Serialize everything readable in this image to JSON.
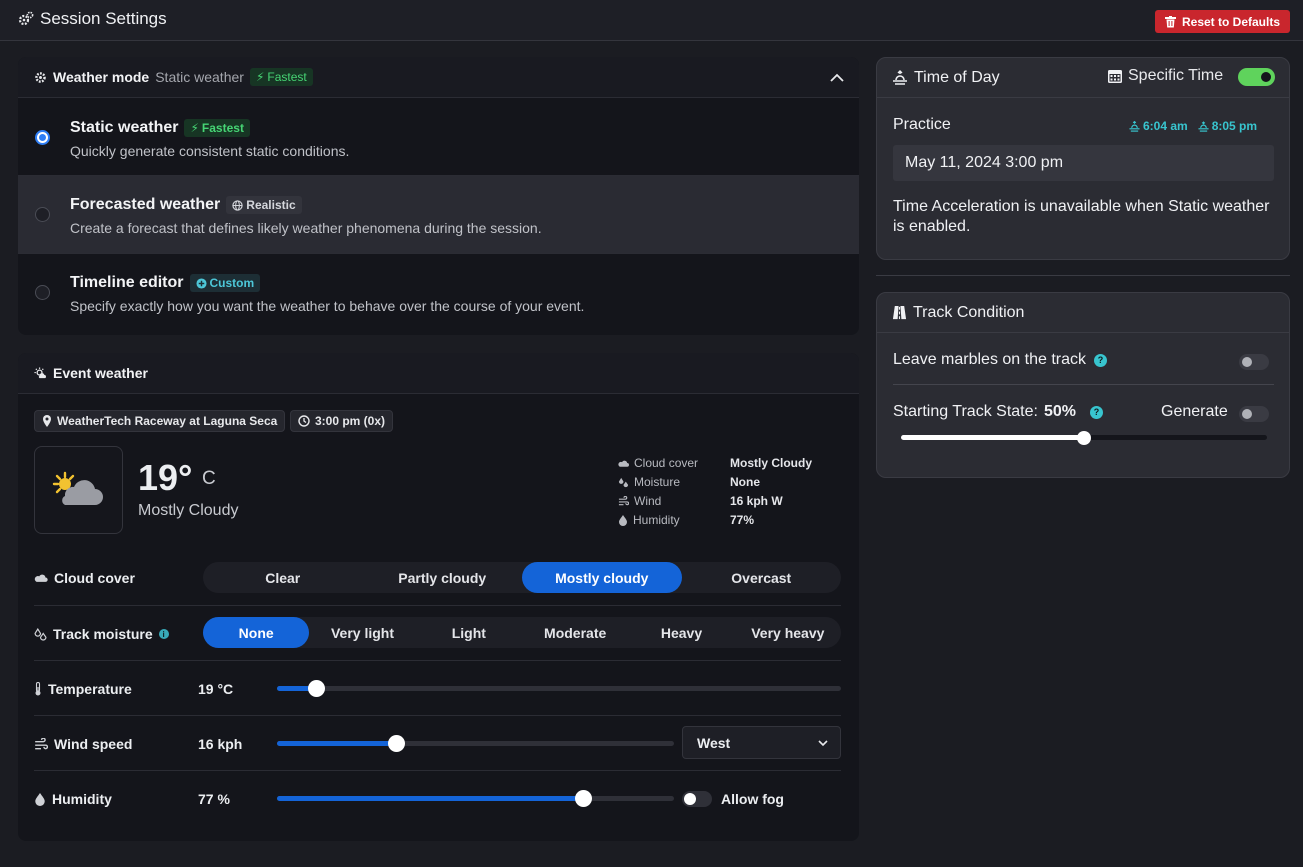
{
  "header": {
    "title": "Session Settings",
    "reset_label": "Reset to Defaults"
  },
  "weather_mode": {
    "label": "Weather mode",
    "current": "Static weather",
    "current_badge": "Fastest",
    "options": [
      {
        "title": "Static weather",
        "badge": "Fastest",
        "desc": "Quickly generate consistent static conditions.",
        "selected": true
      },
      {
        "title": "Forecasted weather",
        "badge": "Realistic",
        "desc": "Create a forecast that defines likely weather phenomena during the session.",
        "selected": false
      },
      {
        "title": "Timeline editor",
        "badge": "Custom",
        "desc": "Specify exactly how you want the weather to behave over the course of your event.",
        "selected": false
      }
    ]
  },
  "event_weather": {
    "title": "Event weather",
    "track": "WeatherTech Raceway at Laguna Seca",
    "time": "3:00 pm (0x)",
    "temp": "19°",
    "unit": "C",
    "condition": "Mostly Cloudy",
    "stats": [
      {
        "label": "Cloud cover",
        "value": "Mostly Cloudy"
      },
      {
        "label": "Moisture",
        "value": "None"
      },
      {
        "label": "Wind",
        "value": "16 kph W"
      },
      {
        "label": "Humidity",
        "value": "77%"
      }
    ],
    "cloud_cover": {
      "label": "Cloud cover",
      "options": [
        "Clear",
        "Partly cloudy",
        "Mostly cloudy",
        "Overcast"
      ],
      "selected": "Mostly cloudy"
    },
    "track_moisture": {
      "label": "Track moisture",
      "options": [
        "None",
        "Very light",
        "Light",
        "Moderate",
        "Heavy",
        "Very heavy"
      ],
      "selected": "None"
    },
    "temperature": {
      "label": "Temperature",
      "value": "19 °C",
      "level": 0.07
    },
    "wind_speed": {
      "label": "Wind speed",
      "value": "16 kph",
      "level": 0.3,
      "direction": "West"
    },
    "humidity": {
      "label": "Humidity",
      "value": "77 %",
      "level": 0.77,
      "fog_label": "Allow fog"
    }
  },
  "time_of_day": {
    "title": "Time of Day",
    "toggle_label": "Specific Time",
    "toggle_on": true,
    "session": "Practice",
    "sunrise": "6:04 am",
    "sunset": "8:05 pm",
    "datetime": "May 11, 2024 3:00 pm",
    "note": "Time Acceleration is unavailable when Static weather is enabled."
  },
  "track_condition": {
    "title": "Track Condition",
    "marbles_label": "Leave marbles on the track",
    "state_label": "Starting Track State:",
    "state_value": "50%",
    "state_level": 0.5,
    "generate_label": "Generate"
  },
  "colors": {
    "accent": "#1464d8",
    "danger": "#c9262d",
    "toggle_on": "#5fd35c",
    "teal": "#38c5cf"
  }
}
